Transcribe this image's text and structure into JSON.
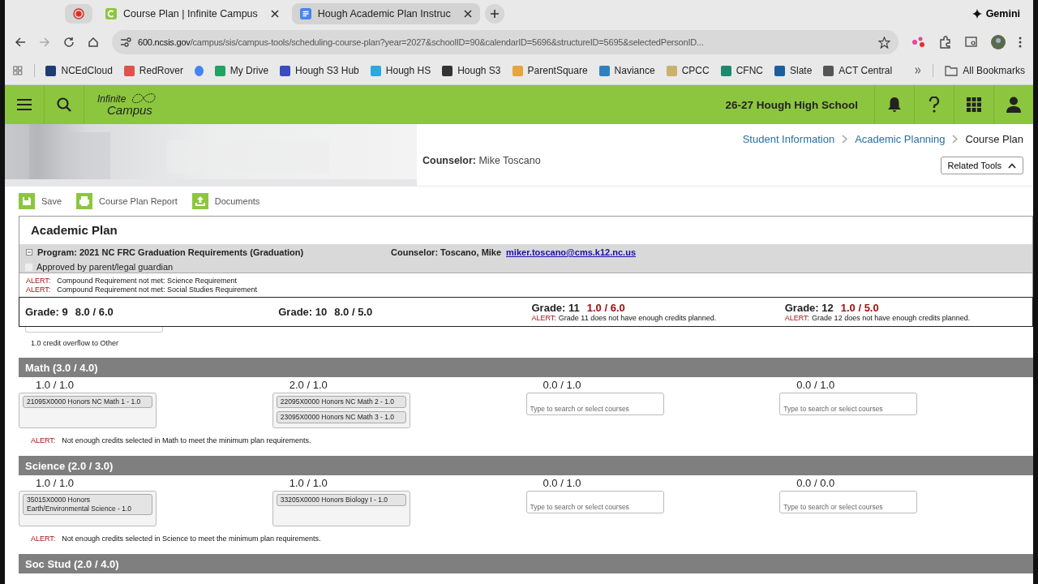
{
  "browser": {
    "tabs": [
      {
        "kind": "record",
        "selected": false
      },
      {
        "kind": "page",
        "title": "Course Plan | Infinite Campus",
        "selected": true
      },
      {
        "kind": "page",
        "title": "Hough Academic Plan Instruc",
        "selected": false
      }
    ],
    "gemini": "Gemini",
    "address": {
      "host": "600.ncsis.gov",
      "path": "/campus/sis/campus-tools/scheduling-course-plan?year=2027&schoolID=90&calendarID=5696&structureID=5695&selectedPersonID..."
    },
    "bookmarks": [
      {
        "label": "NCEdCloud",
        "color": "#1f3b73"
      },
      {
        "label": "RedRover",
        "color": "#e0524b"
      },
      {
        "color": "#4285f4"
      },
      {
        "label": "My Drive",
        "color": "#1fa463"
      },
      {
        "label": "Hough S3 Hub",
        "color": "#3b4cc0"
      },
      {
        "label": "Hough HS",
        "color": "#29a9e0"
      },
      {
        "label": "Hough S3",
        "color": "#333333"
      },
      {
        "label": "ParentSquare",
        "color": "#e8a33d"
      },
      {
        "label": "Naviance",
        "color": "#2f80c0"
      },
      {
        "label": "CPCC",
        "color": "#c9b36b"
      },
      {
        "label": "CFNC",
        "color": "#1d8a6f"
      },
      {
        "label": "Slate",
        "color": "#1b5e9e"
      },
      {
        "label": "ACT Central",
        "color": "#555555"
      }
    ],
    "all_bookmarks": "All Bookmarks"
  },
  "app": {
    "logo_top": "Infinite",
    "logo_bottom": "Campus",
    "school": "26-27 Hough High School",
    "breadcrumbs": [
      "Student Information",
      "Academic Planning",
      "Course Plan"
    ],
    "counselor_label": "Counselor:",
    "counselor_name": "Mike Toscano",
    "related_tools": "Related Tools",
    "actions": [
      "Save",
      "Course Plan Report",
      "Documents"
    ],
    "plan": {
      "title": "Academic Plan",
      "program": "Program: 2021 NC FRC Graduation Requirements (Graduation)",
      "expanded": true,
      "counselor": "Counselor: Toscano, Mike",
      "email": "miker.toscano@cms.k12.nc.us",
      "approved": {
        "label": "Approved by parent/legal guardian",
        "checked": false
      },
      "alerts": [
        {
          "label": "ALERT:",
          "text": "Compound Requirement not met: Science Requirement"
        },
        {
          "label": "ALERT:",
          "text": "Compound Requirement not met: Social Studies Requirement"
        }
      ],
      "grades": [
        {
          "label": "Grade: 9",
          "credits": "8.0 / 6.0",
          "deficient": false
        },
        {
          "label": "Grade: 10",
          "credits": "8.0 / 5.0",
          "deficient": false
        },
        {
          "label": "Grade: 11",
          "credits": "1.0 / 6.0",
          "deficient": true,
          "alert": {
            "label": "ALERT:",
            "text": "Grade 11 does not have enough credits planned."
          }
        },
        {
          "label": "Grade: 12",
          "credits": "1.0 / 5.0",
          "deficient": true,
          "alert": {
            "label": "ALERT:",
            "text": "Grade 12 does not have enough credits planned."
          }
        }
      ],
      "overflow_note": "1.0 credit overflow to Other",
      "subjects": [
        {
          "title": "Math (3.0 / 4.0)",
          "columns": [
            {
              "credits": "1.0 / 1.0",
              "courses": [
                "21095X0000 Honors NC Math 1 - 1.0"
              ]
            },
            {
              "credits": "2.0 / 1.0",
              "courses": [
                "22095X0000 Honors NC Math 2 - 1.0",
                "23095X0000 Honors NC Math 3 - 1.0"
              ]
            },
            {
              "credits": "0.0 / 1.0",
              "placeholder": "Type to search or select courses"
            },
            {
              "credits": "0.0 / 1.0",
              "placeholder": "Type to search or select courses"
            }
          ],
          "alert": {
            "label": "ALERT:",
            "text": "Not enough credits selected in Math to meet the minimum plan requirements."
          }
        },
        {
          "title": "Science (2.0 / 3.0)",
          "columns": [
            {
              "credits": "1.0 / 1.0",
              "courses": [
                "35015X0000 Honors Earth/Environmental Science - 1.0"
              ]
            },
            {
              "credits": "1.0 / 1.0",
              "courses": [
                "33205X0000 Honors Biology I - 1.0"
              ]
            },
            {
              "credits": "0.0 / 1.0",
              "placeholder": "Type to search or select courses"
            },
            {
              "credits": "0.0 / 0.0",
              "placeholder": "Type to search or select courses"
            }
          ],
          "alert": {
            "label": "ALERT:",
            "text": "Not enough credits selected in Science to meet the minimum plan requirements."
          }
        },
        {
          "title": "Soc Stud (2.0 / 4.0)"
        }
      ]
    }
  }
}
